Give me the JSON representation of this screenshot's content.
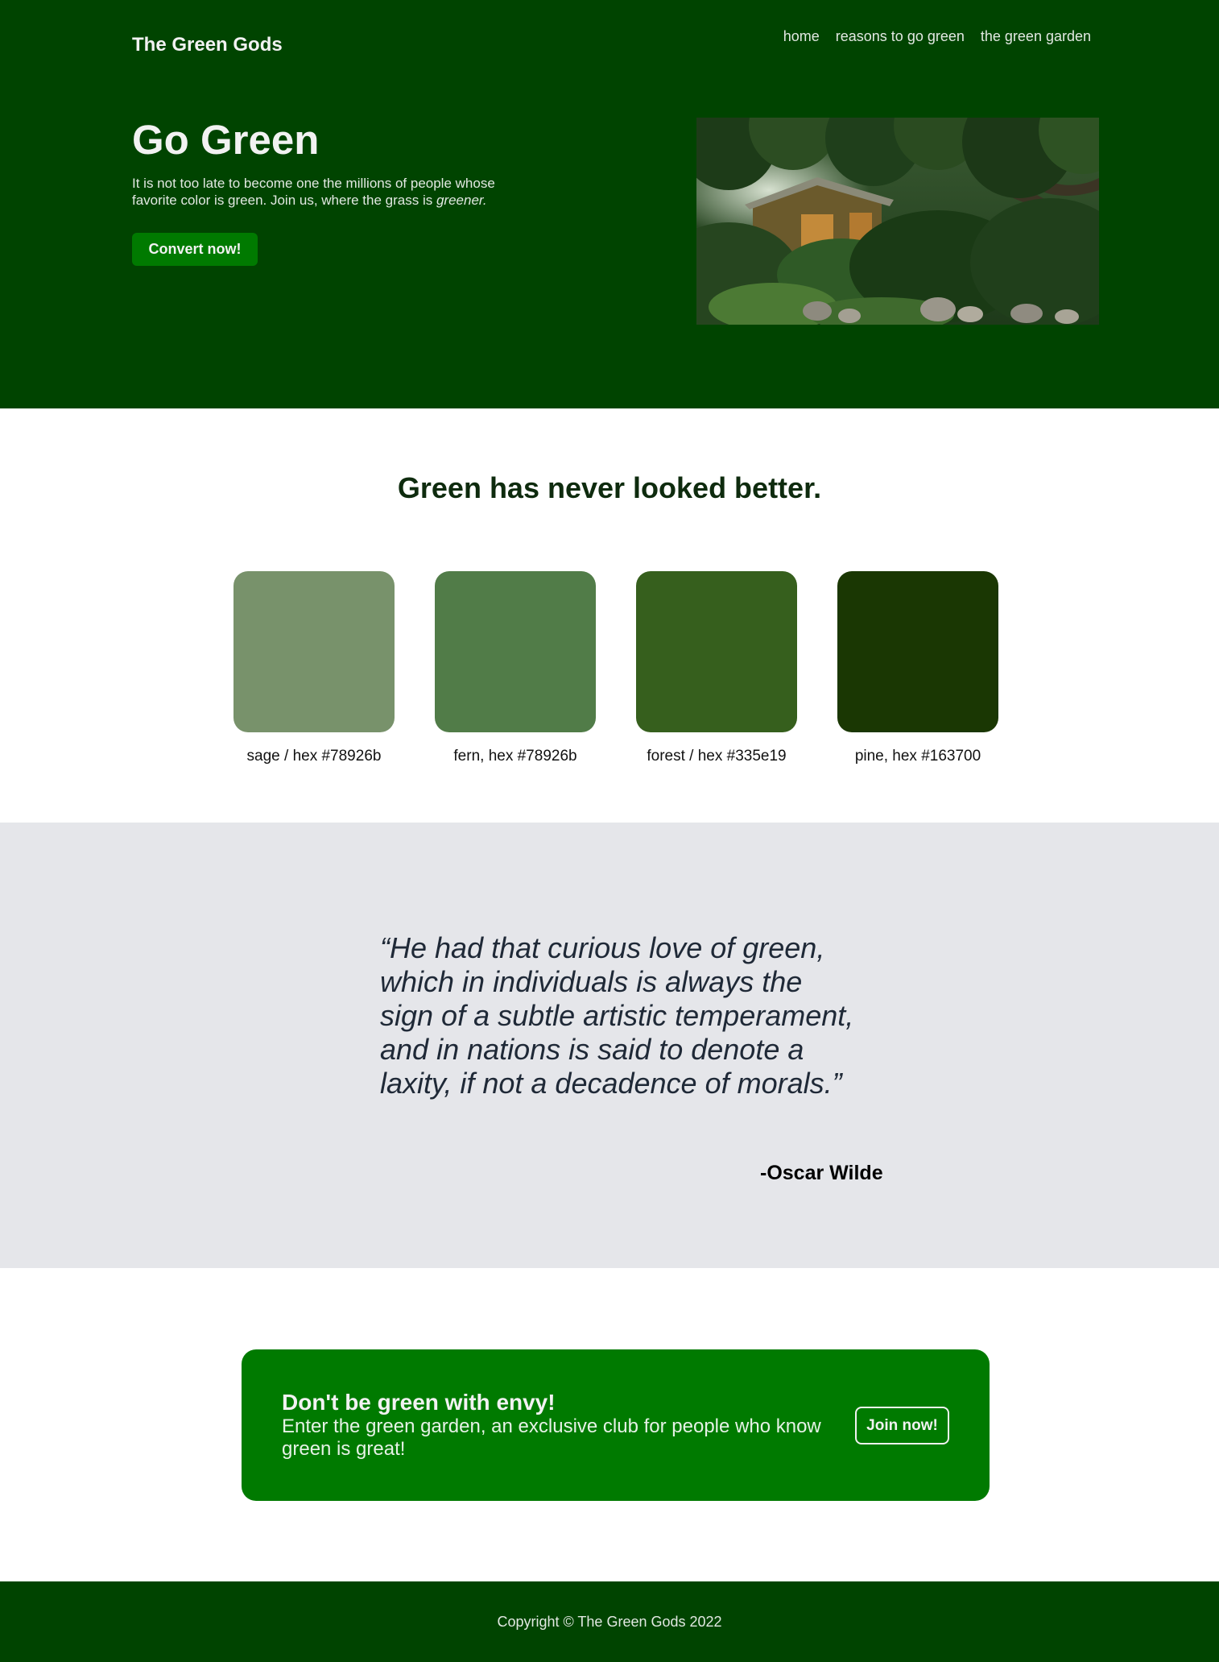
{
  "site": {
    "brand": "The Green Gods"
  },
  "nav": {
    "items": [
      "home",
      "reasons to go green",
      "the green garden"
    ]
  },
  "hero": {
    "title": "Go Green",
    "text": "It is not too late to become one the millions of people whose favorite color is green. Join us, where the grass is",
    "text_em": "greener.",
    "cta_label": "Convert now!"
  },
  "swatches": {
    "heading": "Green has never looked better.",
    "items": [
      {
        "label": "sage / hex #78926b",
        "color": "#78926b"
      },
      {
        "label": "fern, hex #78926b",
        "color": "#517c48"
      },
      {
        "label": "forest / hex #335e19",
        "color": "#365f1d"
      },
      {
        "label": "pine, hex #163700",
        "color": "#1a3703"
      }
    ]
  },
  "quote": {
    "text": "“He had that curious love of green, which in individuals is always the sign of a subtle artistic temperament, and in nations is said to denote a laxity, if not a decadence of morals.”",
    "author": "-Oscar Wilde"
  },
  "join": {
    "title": "Don't be green with envy!",
    "text": "Enter the green garden, an exclusive club for people who know green is great!",
    "button_label": "Join now!"
  },
  "footer": {
    "copyright": "Copyright © The Green Gods 2022"
  },
  "colors": {
    "hero_bg": "#004400",
    "accent": "#007a00",
    "quote_bg": "#e5e6ea"
  }
}
